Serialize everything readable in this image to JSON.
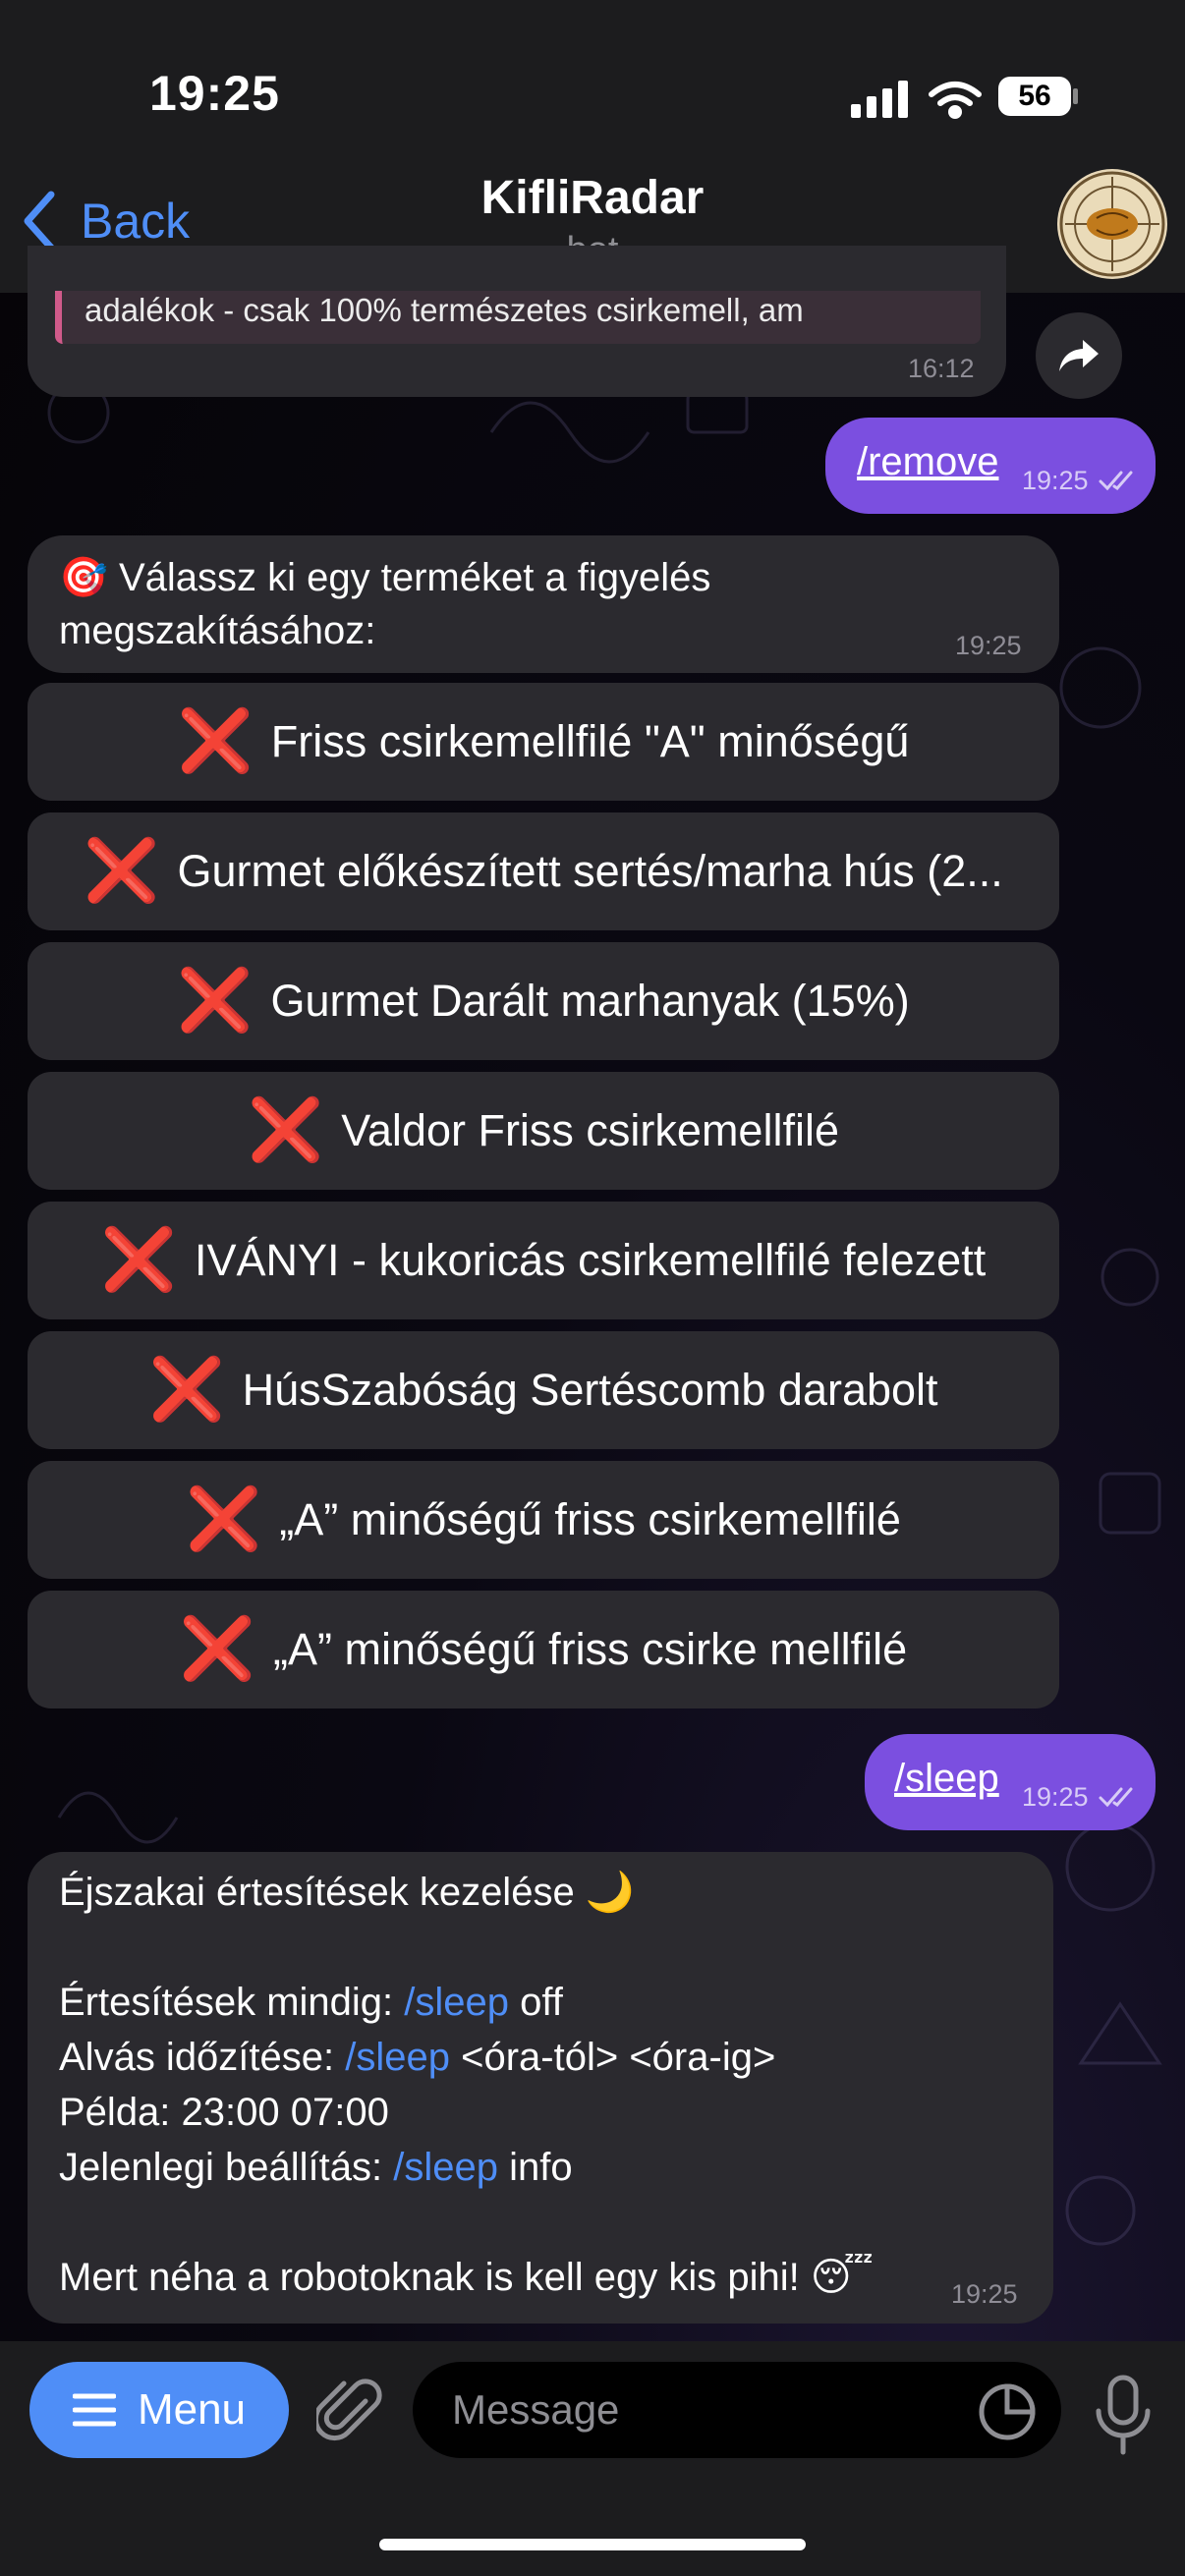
{
  "status": {
    "time": "19:25",
    "battery": "56"
  },
  "header": {
    "back_label": "Back",
    "title": "KifliRadar",
    "subtitle": "bot"
  },
  "prev_message": {
    "text": "adalékok - csak 100% természetes csirkemell, am",
    "time": "16:12"
  },
  "outgoing_remove": {
    "text": "/remove",
    "time": "19:25"
  },
  "remove_prompt": {
    "emoji": "🎯",
    "line1": "Válassz ki egy terméket a figyelés",
    "line2": "megszakításához:",
    "time": "19:25"
  },
  "keyboard": {
    "x_icon": "❌",
    "buttons": [
      "Friss csirkemellfilé \"A\" minőségű",
      "Gurmet előkészített sertés/marha hús (2...",
      "Gurmet Darált marhanyak (15%)",
      "Valdor Friss csirkemellfilé",
      "IVÁNYI - kukoricás csirkemellfilé felezett",
      "HúsSzabóság Sertéscomb darabolt",
      "„A” minőségű friss csirkemellfilé",
      "„A” minőségű friss csirke mellfilé"
    ]
  },
  "outgoing_sleep": {
    "text": "/sleep",
    "time": "19:25"
  },
  "sleep_message": {
    "title": "Éjszakai értesítések kezelése 🌙",
    "line1_pre": "Értesítések mindig: ",
    "line1_cmd": "/sleep",
    "line1_post": " off",
    "line2_pre": "Alvás időzítése: ",
    "line2_cmd": "/sleep",
    "line2_post": " <óra-tól> <óra-ig>",
    "line3": "Példa: 23:00 07:00",
    "line4_pre": "Jelenlegi beállítás: ",
    "line4_cmd": "/sleep",
    "line4_post": " info",
    "line5": "Mert néha a robotoknak is kell egy kis pihi! 😴",
    "time": "19:25"
  },
  "bottom": {
    "menu_label": "Menu",
    "input_placeholder": "Message"
  },
  "colors": {
    "accent": "#4f8ef7",
    "outgoing_bubble": "#7b4fe0",
    "incoming_bubble": "#2b2a2f",
    "remove_icon": "#e53935"
  },
  "icons": [
    "chevron-left-icon",
    "forward-icon",
    "read-checkmarks-icon",
    "hamburger-icon",
    "paperclip-icon",
    "sticker-icon",
    "microphone-icon",
    "signal-icon",
    "wifi-icon",
    "battery-icon"
  ]
}
